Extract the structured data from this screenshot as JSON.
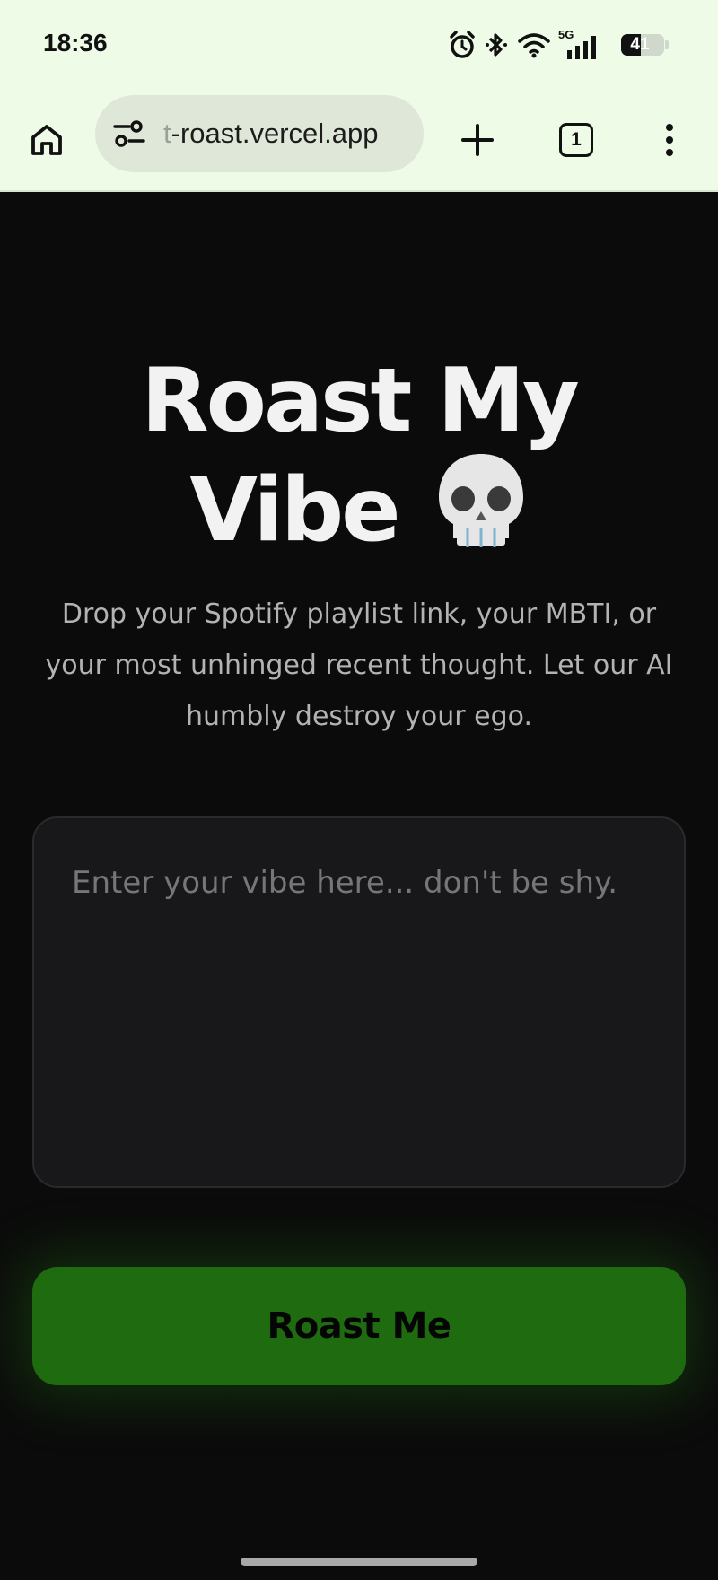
{
  "status_bar": {
    "time": "18:36",
    "network_label": "5G",
    "battery_level": "41"
  },
  "browser": {
    "url_faded_prefix": "t",
    "url_text": "-roast.vercel.app",
    "tab_count": "1",
    "icons": [
      "home-icon",
      "site-settings-icon",
      "new-tab-icon",
      "tab-switcher-icon",
      "more-options-icon"
    ]
  },
  "page": {
    "title_line1": "Roast My",
    "title_line2": "Vibe",
    "title_emoji": "skull-icon",
    "subtitle": "Drop your Spotify playlist link, your MBTI, or your most unhinged recent thought. Let our AI humbly destroy your ego.",
    "input_placeholder": "Enter your vibe here... don't be shy.",
    "input_value": "",
    "button_label": "Roast Me",
    "accent_color": "#1f6b10"
  }
}
